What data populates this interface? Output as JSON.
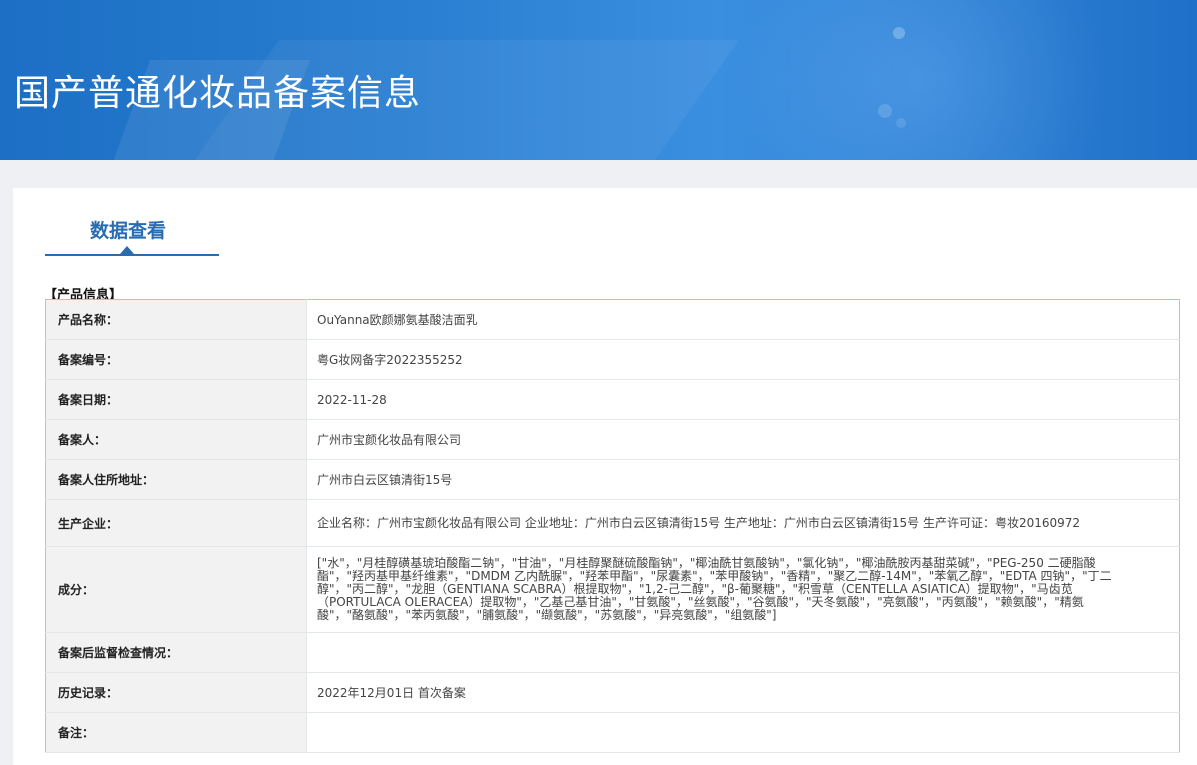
{
  "header": {
    "title": "国产普通化妆品备案信息"
  },
  "tab": {
    "label": "数据查看"
  },
  "section": {
    "title": "【产品信息】"
  },
  "rows": [
    {
      "label": "产品名称：",
      "value": "OuYanna欧颜娜氨基酸洁面乳"
    },
    {
      "label": "备案编号：",
      "value": "粤G妆网备字2022355252"
    },
    {
      "label": "备案日期：",
      "value": "2022-11-28"
    },
    {
      "label": "备案人：",
      "value": "广州市宝颜化妆品有限公司"
    },
    {
      "label": "备案人住所地址：",
      "value": "广州市白云区镇清街15号"
    },
    {
      "label": "生产企业：",
      "value": "企业名称：广州市宝颜化妆品有限公司 企业地址：广州市白云区镇清街15号 生产地址：广州市白云区镇清街15号 生产许可证：粤妆20160972"
    },
    {
      "label": "成分：",
      "value": "[\"水\"，\"月桂醇磺基琥珀酸酯二钠\"，\"甘油\"，\"月桂醇聚醚硫酸酯钠\"，\"椰油酰甘氨酸钠\"，\"氯化钠\"，\"椰油酰胺丙基甜菜碱\"，\"PEG-250 二硬脂酸酯\"，\"羟丙基甲基纤维素\"，\"DMDM 乙内酰脲\"，\"羟苯甲酯\"，\"尿囊素\"，\"苯甲酸钠\"，\"香精\"，\"聚乙二醇-14M\"，\"苯氧乙醇\"，\"EDTA 四钠\"，\"丁二醇\"，\"丙二醇\"，\"龙胆（GENTIANA SCABRA）根提取物\"，\"1,2-己二醇\"，\"β-葡聚糖\"，\"积雪草（CENTELLA ASIATICA）提取物\"，\"马齿苋（PORTULACA OLERACEA）提取物\"，\"乙基己基甘油\"，\"甘氨酸\"，\"丝氨酸\"，\"谷氨酸\"，\"天冬氨酸\"，\"亮氨酸\"，\"丙氨酸\"，\"赖氨酸\"，\"精氨酸\"，\"酪氨酸\"，\"苯丙氨酸\"，\"脯氨酸\"，\"缬氨酸\"，\"苏氨酸\"，\"异亮氨酸\"，\"组氨酸\"]"
    },
    {
      "label": "备案后监督检查情况：",
      "value": ""
    },
    {
      "label": "历史记录：",
      "value": "2022年12月01日 首次备案"
    },
    {
      "label": "备注：",
      "value": ""
    }
  ]
}
